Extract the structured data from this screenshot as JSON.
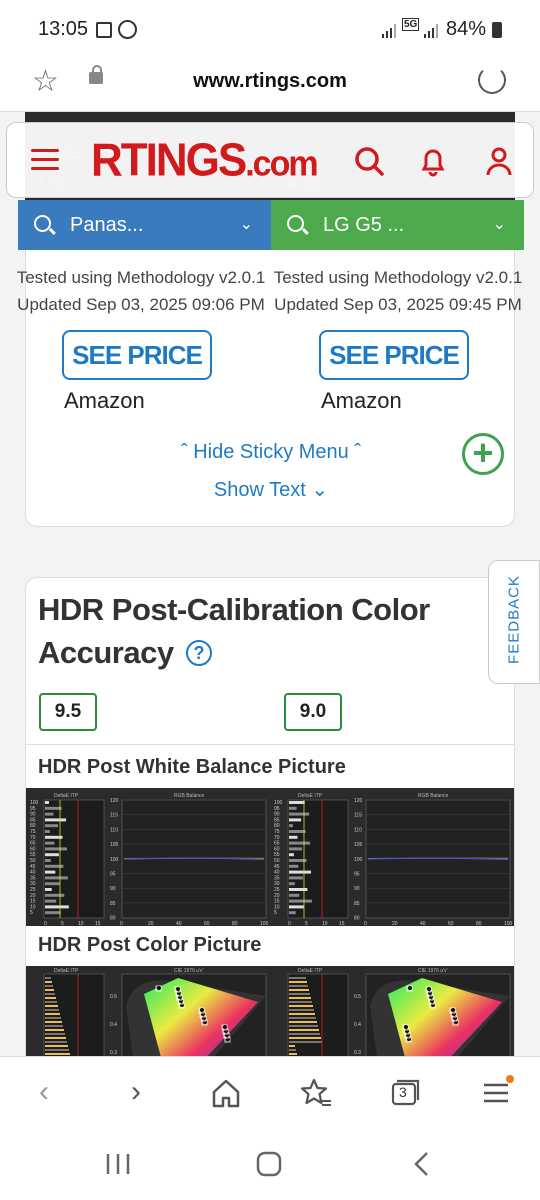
{
  "status": {
    "time": "13:05",
    "network": "5G",
    "battery": "84%"
  },
  "browser": {
    "url": "www.rtings.com",
    "tab_count": "3"
  },
  "site": {
    "logo_main": "RTINGS",
    "logo_suffix": ".com"
  },
  "compare": [
    {
      "label": "Panas...",
      "color": "#3a7bc0"
    },
    {
      "label": "LG G5 ...",
      "color": "#4caa4c"
    }
  ],
  "sticky": {
    "products": [
      {
        "methodology": "Tested using Methodology v2.0.1",
        "updated": "Updated Sep 03, 2025 09:06 PM",
        "button": "SEE PRICE",
        "store": "Amazon"
      },
      {
        "methodology": "Tested using Methodology v2.0.1",
        "updated": "Updated Sep 03, 2025 09:45 PM",
        "button": "SEE PRICE",
        "store": "Amazon"
      }
    ],
    "hide_menu": "Hide Sticky Menu",
    "show_text": "Show Text"
  },
  "feedback": "FEEDBACK",
  "section": {
    "title_line1": "HDR Post-Calibration Color",
    "title_line2": "Accuracy",
    "help": "?",
    "scores": [
      "9.5",
      "9.0"
    ],
    "white_balance_title": "HDR Post White Balance Picture",
    "color_title": "HDR Post Color Picture",
    "deltae_label": "DeltaE ITP",
    "rgb_label": "RGB Balance",
    "cie_label": "CIE 1976 u'v'",
    "deltae_ticks_y": [
      "100",
      "95",
      "90",
      "85",
      "80",
      "75",
      "70",
      "65",
      "60",
      "55",
      "50",
      "45",
      "40",
      "35",
      "30",
      "25",
      "20",
      "15",
      "10",
      "5"
    ],
    "deltae_ticks_x": [
      "0",
      "5",
      "10",
      "15"
    ],
    "rgb_ticks_y": [
      "120",
      "115",
      "110",
      "105",
      "100",
      "95",
      "90",
      "85",
      "80"
    ],
    "rgb_ticks_x": [
      "0",
      "20",
      "40",
      "60",
      "80",
      "100"
    ],
    "cie_ticks_y": [
      "0.5",
      "0.4",
      "0.3"
    ]
  }
}
